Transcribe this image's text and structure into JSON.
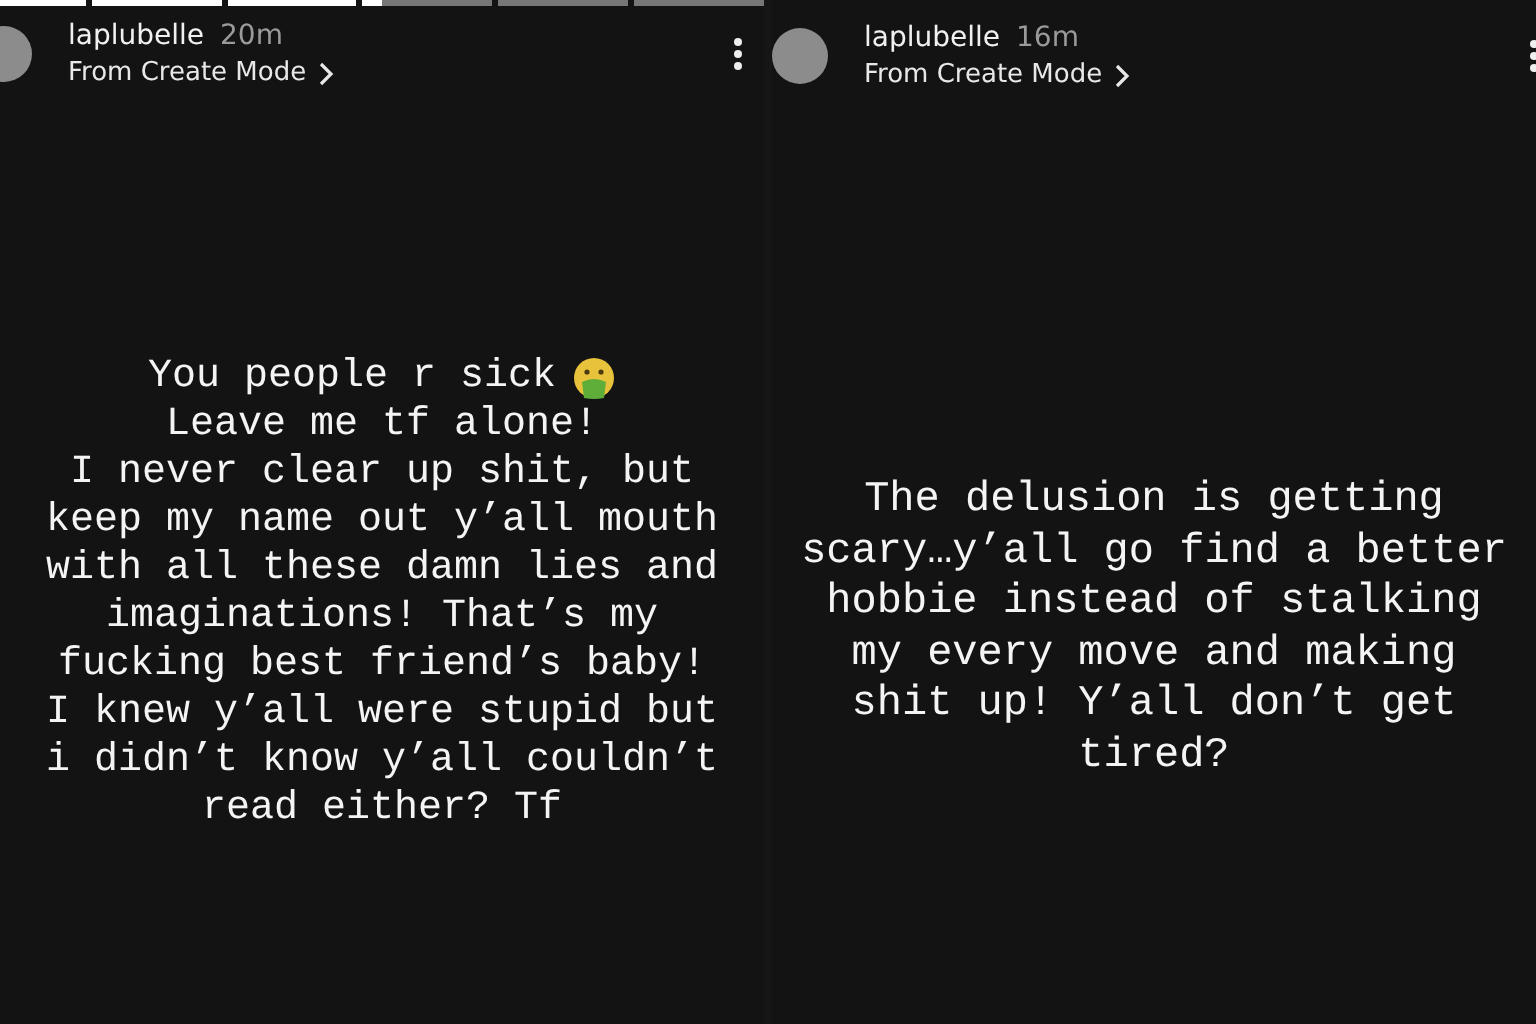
{
  "stories": [
    {
      "progress": [
        {
          "level": 1
        },
        {
          "level": 1
        },
        {
          "level": 1
        },
        {
          "level": 0.15
        },
        {
          "level": 0
        },
        {
          "level": 0
        }
      ],
      "username": "laplubelle",
      "time": "20m",
      "subtitle": "From Create Mode",
      "caption_head": "You people r sick",
      "caption_body": "Leave me tf alone!\nI never clear up shit, but\nkeep my name out y’all mouth\nwith all these damn lies and\nimaginations! That’s my\nfucking best friend’s baby!\nI knew y’all were stupid but\ni didn’t know y’all couldn’t\nread either? Tf"
    },
    {
      "username": "laplubelle",
      "time": "16m",
      "subtitle": "From Create Mode",
      "caption_body": "The delusion is getting\nscary…y’all go find a better\nhobbie instead of stalking\nmy every move and making\nshit up! Y’all don’t get\ntired?"
    }
  ]
}
